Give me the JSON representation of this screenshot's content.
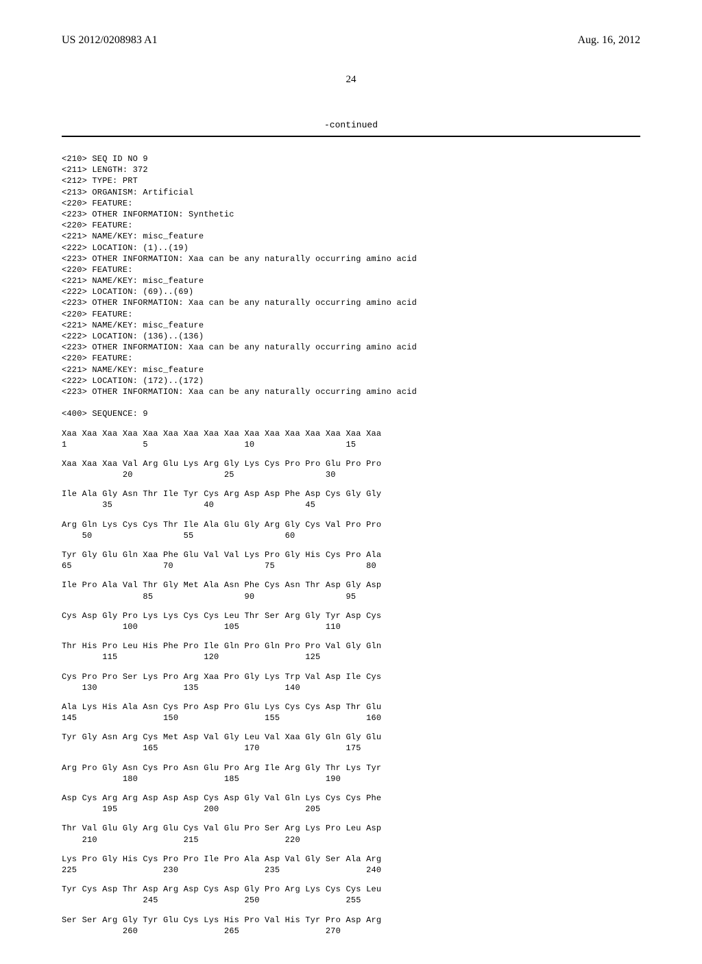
{
  "header": {
    "pub_number": "US 2012/0208983 A1",
    "pub_date": "Aug. 16, 2012"
  },
  "page_number": "24",
  "continued_label": "-continued",
  "annotations": [
    "<210> SEQ ID NO 9",
    "<211> LENGTH: 372",
    "<212> TYPE: PRT",
    "<213> ORGANISM: Artificial",
    "<220> FEATURE:",
    "<223> OTHER INFORMATION: Synthetic",
    "<220> FEATURE:",
    "<221> NAME/KEY: misc_feature",
    "<222> LOCATION: (1)..(19)",
    "<223> OTHER INFORMATION: Xaa can be any naturally occurring amino acid",
    "<220> FEATURE:",
    "<221> NAME/KEY: misc_feature",
    "<222> LOCATION: (69)..(69)",
    "<223> OTHER INFORMATION: Xaa can be any naturally occurring amino acid",
    "<220> FEATURE:",
    "<221> NAME/KEY: misc_feature",
    "<222> LOCATION: (136)..(136)",
    "<223> OTHER INFORMATION: Xaa can be any naturally occurring amino acid",
    "<220> FEATURE:",
    "<221> NAME/KEY: misc_feature",
    "<222> LOCATION: (172)..(172)",
    "<223> OTHER INFORMATION: Xaa can be any naturally occurring amino acid",
    "",
    "<400> SEQUENCE: 9"
  ],
  "sequence_rows": [
    {
      "aa": "Xaa Xaa Xaa Xaa Xaa Xaa Xaa Xaa Xaa Xaa Xaa Xaa Xaa Xaa Xaa Xaa",
      "num": "1               5                   10                  15"
    },
    {
      "aa": "Xaa Xaa Xaa Val Arg Glu Lys Arg Gly Lys Cys Pro Pro Glu Pro Pro",
      "num": "            20                  25                  30"
    },
    {
      "aa": "Ile Ala Gly Asn Thr Ile Tyr Cys Arg Asp Asp Phe Asp Cys Gly Gly",
      "num": "        35                  40                  45"
    },
    {
      "aa": "Arg Gln Lys Cys Cys Thr Ile Ala Glu Gly Arg Gly Cys Val Pro Pro",
      "num": "    50                  55                  60"
    },
    {
      "aa": "Tyr Gly Glu Gln Xaa Phe Glu Val Val Lys Pro Gly His Cys Pro Ala",
      "num": "65                  70                  75                  80"
    },
    {
      "aa": "Ile Pro Ala Val Thr Gly Met Ala Asn Phe Cys Asn Thr Asp Gly Asp",
      "num": "                85                  90                  95"
    },
    {
      "aa": "Cys Asp Gly Pro Lys Lys Cys Cys Leu Thr Ser Arg Gly Tyr Asp Cys",
      "num": "            100                 105                 110"
    },
    {
      "aa": "Thr His Pro Leu His Phe Pro Ile Gln Pro Gln Pro Pro Val Gly Gln",
      "num": "        115                 120                 125"
    },
    {
      "aa": "Cys Pro Pro Ser Lys Pro Arg Xaa Pro Gly Lys Trp Val Asp Ile Cys",
      "num": "    130                 135                 140"
    },
    {
      "aa": "Ala Lys His Ala Asn Cys Pro Asp Pro Glu Lys Cys Cys Asp Thr Glu",
      "num": "145                 150                 155                 160"
    },
    {
      "aa": "Tyr Gly Asn Arg Cys Met Asp Val Gly Leu Val Xaa Gly Gln Gly Glu",
      "num": "                165                 170                 175"
    },
    {
      "aa": "Arg Pro Gly Asn Cys Pro Asn Glu Pro Arg Ile Arg Gly Thr Lys Tyr",
      "num": "            180                 185                 190"
    },
    {
      "aa": "Asp Cys Arg Arg Asp Asp Asp Cys Asp Gly Val Gln Lys Cys Cys Phe",
      "num": "        195                 200                 205"
    },
    {
      "aa": "Thr Val Glu Gly Arg Glu Cys Val Glu Pro Ser Arg Lys Pro Leu Asp",
      "num": "    210                 215                 220"
    },
    {
      "aa": "Lys Pro Gly His Cys Pro Pro Ile Pro Ala Asp Val Gly Ser Ala Arg",
      "num": "225                 230                 235                 240"
    },
    {
      "aa": "Tyr Cys Asp Thr Asp Arg Asp Cys Asp Gly Pro Arg Lys Cys Cys Leu",
      "num": "                245                 250                 255"
    },
    {
      "aa": "Ser Ser Arg Gly Tyr Glu Cys Lys His Pro Val His Tyr Pro Asp Arg",
      "num": "            260                 265                 270"
    }
  ]
}
